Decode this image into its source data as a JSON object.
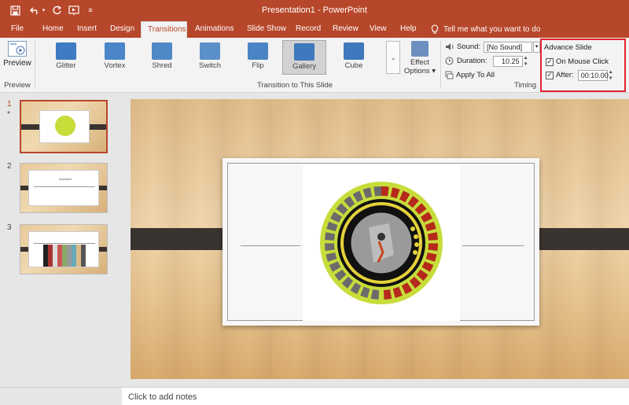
{
  "window": {
    "title": "Presentation1 - PowerPoint",
    "brand_color": "#b7472a"
  },
  "quick_access": {
    "icons": [
      "save-icon",
      "undo-icon",
      "redo-icon",
      "start-from-beginning-icon",
      "customize-icon"
    ]
  },
  "tabs": [
    {
      "label": "File"
    },
    {
      "label": "Home"
    },
    {
      "label": "Insert"
    },
    {
      "label": "Design"
    },
    {
      "label": "Transitions",
      "active": true
    },
    {
      "label": "Animations"
    },
    {
      "label": "Slide Show"
    },
    {
      "label": "Record"
    },
    {
      "label": "Review"
    },
    {
      "label": "View"
    },
    {
      "label": "Help"
    }
  ],
  "tell_me": "Tell me what you want to do",
  "ribbon": {
    "preview": {
      "button_label": "Preview",
      "group_label": "Preview"
    },
    "transitions_group_label": "Transition to This Slide",
    "transitions": [
      {
        "label": "Glitter",
        "color": "#3d7bc4"
      },
      {
        "label": "Vortex",
        "color": "#4a86c8"
      },
      {
        "label": "Shred",
        "color": "#4f88c6"
      },
      {
        "label": "Switch",
        "color": "#5b8fc9"
      },
      {
        "label": "Flip",
        "color": "#4b84c4"
      },
      {
        "label": "Gallery",
        "color": "#3f78bd",
        "selected": true
      },
      {
        "label": "Cube",
        "color": "#3f78bd"
      }
    ],
    "effect_options": {
      "line1": "Effect",
      "line2": "Options"
    },
    "timing": {
      "group_label": "Timing",
      "sound_label": "Sound:",
      "sound_value": "[No Sound]",
      "duration_label": "Duration:",
      "duration_value": "10.25",
      "apply_to_all": "Apply To All"
    },
    "advance": {
      "title": "Advance Slide",
      "on_mouse_click": "On Mouse Click",
      "on_mouse_click_checked": true,
      "after_label": "After:",
      "after_checked": true,
      "after_value": "00:10.00",
      "highlight_color": "#e0232e"
    }
  },
  "slides": [
    {
      "number": "1",
      "star": "*",
      "selected": true
    },
    {
      "number": "2",
      "star": ""
    },
    {
      "number": "3",
      "star": ""
    }
  ],
  "notes_placeholder": "Click to add notes"
}
